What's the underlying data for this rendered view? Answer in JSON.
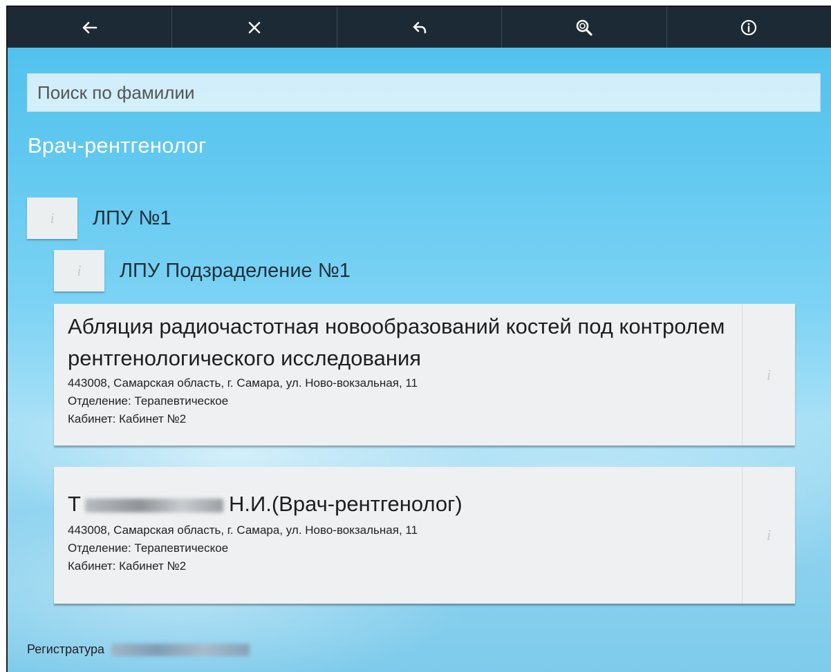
{
  "toolbar": {
    "buttons": [
      {
        "icon": "back-arrow-icon"
      },
      {
        "icon": "close-icon"
      },
      {
        "icon": "reply-icon"
      },
      {
        "icon": "search-icon"
      },
      {
        "icon": "info-icon"
      }
    ]
  },
  "search": {
    "placeholder": "Поиск по фамилии",
    "value": ""
  },
  "specialty_title": "Врач-рентгенолог",
  "lpu": {
    "info_glyph": "i",
    "label": "ЛПУ №1"
  },
  "subdivision": {
    "info_glyph": "i",
    "label": "ЛПУ Подзраделение №1"
  },
  "cards": [
    {
      "title": "Абляция радиочастотная новообразований костей под контролем рентгенологического исследования",
      "address": "443008, Самарская область, г. Самара, ул. Ново-вокзальная, 11",
      "department": "Отделение: Терапевтическое",
      "cabinet": "Кабинет: Кабинет №2",
      "info_glyph": "i"
    },
    {
      "title_prefix": "Т",
      "title_suffix": "Н.И.(Врач-рентгенолог)",
      "address": "443008, Самарская область, г. Самара, ул. Ново-вокзальная, 11",
      "department": "Отделение: Терапевтическое",
      "cabinet": "Кабинет: Кабинет №2",
      "info_glyph": "i"
    }
  ],
  "footer": {
    "label": "Регистратура"
  }
}
